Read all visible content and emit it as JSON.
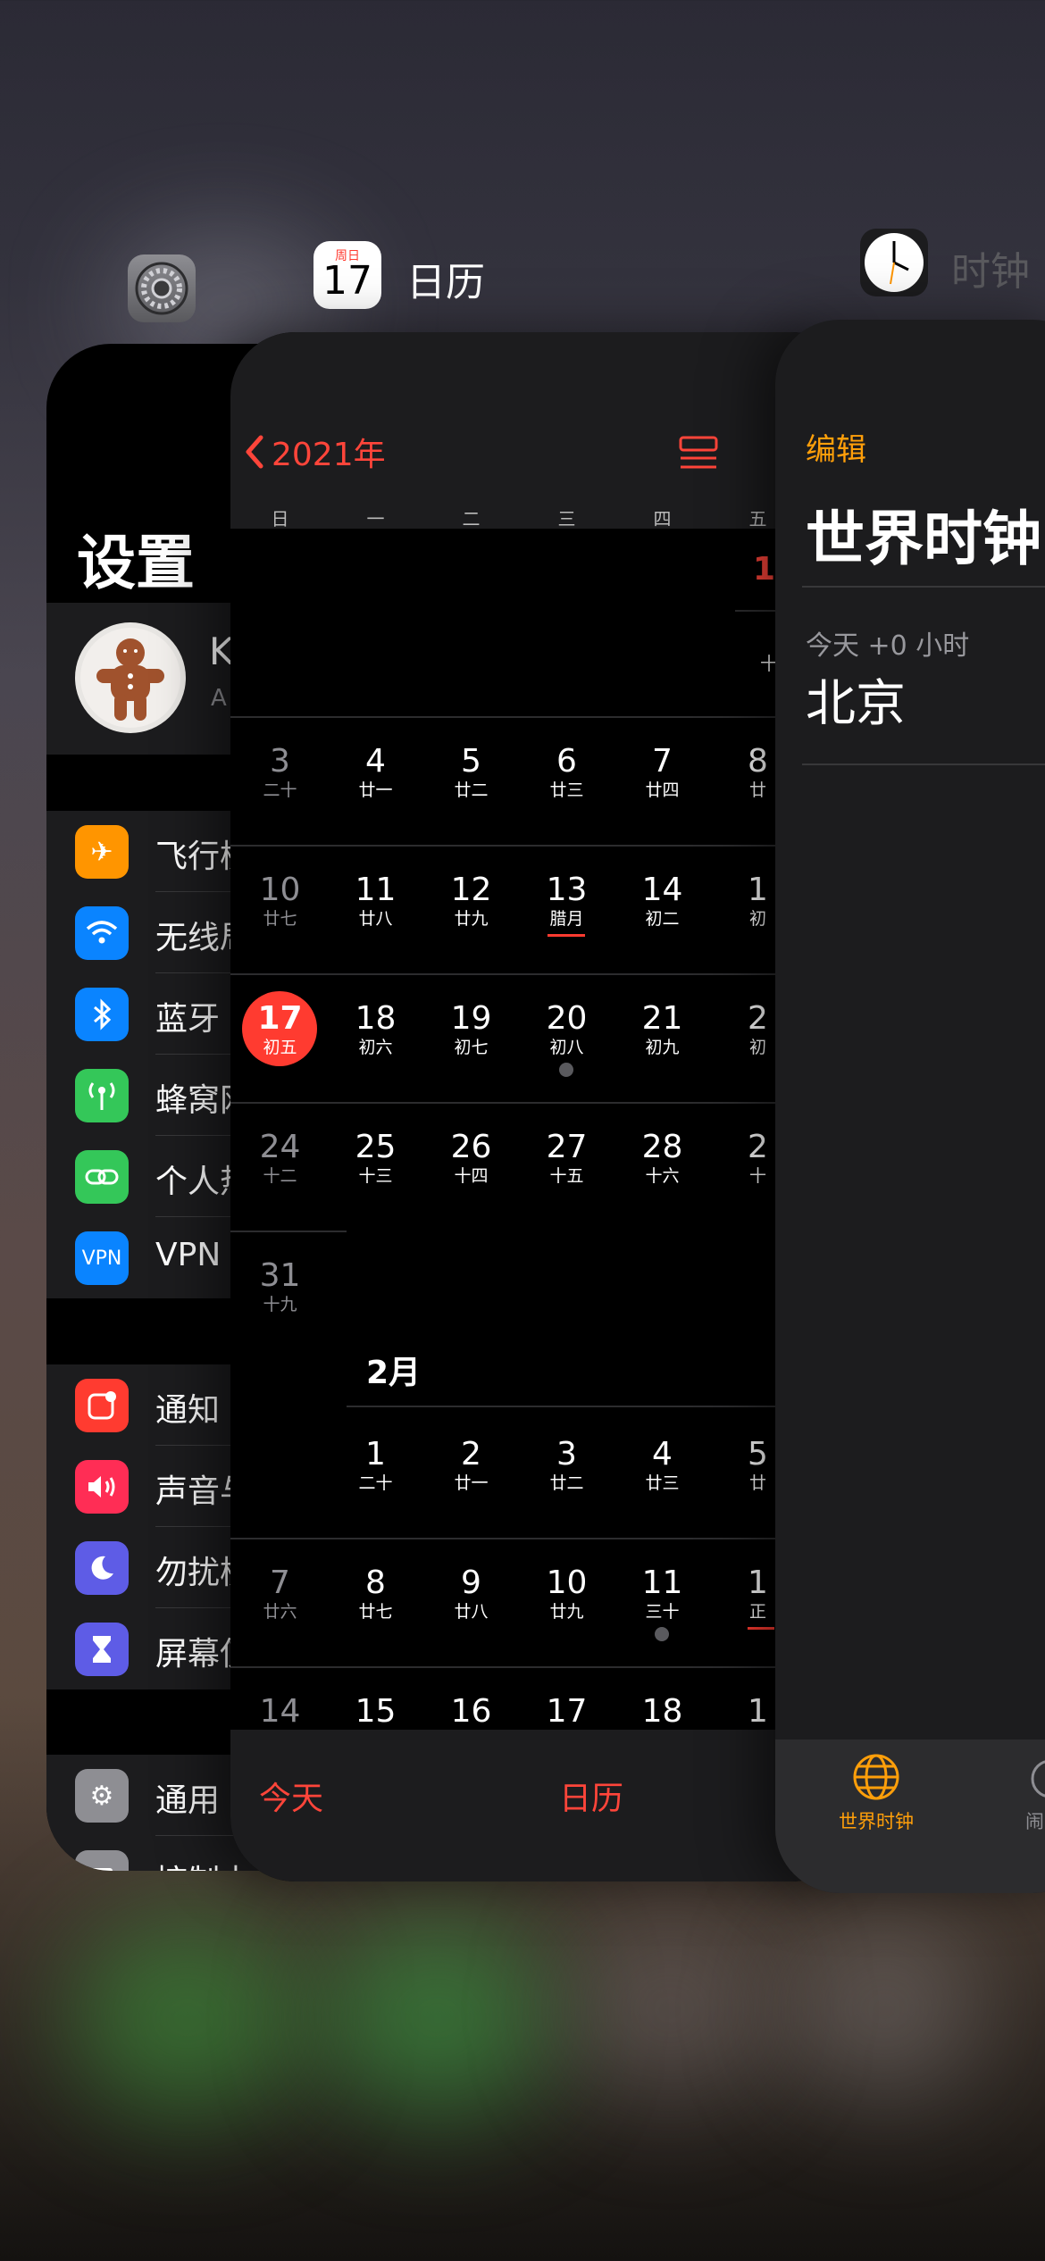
{
  "headers": {
    "calendar_icon_weekday": "周日",
    "calendar_icon_day": "17",
    "calendar_title": "日历",
    "clock_title": "时钟"
  },
  "settings": {
    "title": "设置",
    "profile_initial": "K",
    "profile_sub": "A",
    "group1": [
      {
        "label": "飞行模",
        "icon": "airplane-icon",
        "color": "#ff9500"
      },
      {
        "label": "无线局",
        "icon": "wifi-icon",
        "color": "#0a84ff"
      },
      {
        "label": "蓝牙",
        "icon": "bluetooth-icon",
        "color": "#0a84ff"
      },
      {
        "label": "蜂窝网",
        "icon": "cellular-icon",
        "color": "#34c759"
      },
      {
        "label": "个人热",
        "icon": "hotspot-icon",
        "color": "#34c759"
      },
      {
        "label": "VPN",
        "icon": "vpn-icon",
        "color": "#0a84ff"
      }
    ],
    "group2": [
      {
        "label": "通知",
        "icon": "notification-icon",
        "color": "#ff3b30"
      },
      {
        "label": "声音与",
        "icon": "sound-icon",
        "color": "#ff2d55"
      },
      {
        "label": "勿扰模",
        "icon": "moon-icon",
        "color": "#5e5ce6"
      },
      {
        "label": "屏幕使",
        "icon": "hourglass-icon",
        "color": "#5e5ce6"
      }
    ],
    "group3": [
      {
        "label": "通用",
        "icon": "gear-icon",
        "color": "#8e8e93"
      },
      {
        "label": "控制中心",
        "icon": "control-center-icon",
        "color": "#8e8e93"
      }
    ]
  },
  "calendar": {
    "back_label": "2021年",
    "weekdays": [
      "日",
      "一",
      "二",
      "三",
      "四",
      "五"
    ],
    "jan_first": "1",
    "jan_first_lunar": "十",
    "weeks": [
      [
        [
          "3",
          "二十",
          true
        ],
        [
          "4",
          "廿一",
          false
        ],
        [
          "5",
          "廿二",
          false
        ],
        [
          "6",
          "廿三",
          false
        ],
        [
          "7",
          "廿四",
          false
        ],
        [
          "8",
          "廿",
          false
        ]
      ],
      [
        [
          "10",
          "廿七",
          true
        ],
        [
          "11",
          "廿八",
          false
        ],
        [
          "12",
          "廿九",
          false
        ],
        [
          "13",
          "腊月",
          false
        ],
        [
          "14",
          "初二",
          false
        ],
        [
          "1",
          "初",
          false
        ]
      ],
      [
        [
          "17",
          "初五",
          false
        ],
        [
          "18",
          "初六",
          false
        ],
        [
          "19",
          "初七",
          false
        ],
        [
          "20",
          "初八",
          false
        ],
        [
          "21",
          "初九",
          false
        ],
        [
          "2",
          "初",
          false
        ]
      ],
      [
        [
          "24",
          "十二",
          true
        ],
        [
          "25",
          "十三",
          false
        ],
        [
          "26",
          "十四",
          false
        ],
        [
          "27",
          "十五",
          false
        ],
        [
          "28",
          "十六",
          false
        ],
        [
          "2",
          "十",
          false
        ]
      ],
      [
        [
          "31",
          "十九",
          true
        ]
      ]
    ],
    "feb_label": "2月",
    "feb_weeks": [
      [
        [
          "1",
          "二十",
          false
        ],
        [
          "2",
          "廿一",
          false
        ],
        [
          "3",
          "廿二",
          false
        ],
        [
          "4",
          "廿三",
          false
        ],
        [
          "5",
          "廿",
          false
        ]
      ],
      [
        [
          "7",
          "廿六",
          true
        ],
        [
          "8",
          "廿七",
          false
        ],
        [
          "9",
          "廿八",
          false
        ],
        [
          "10",
          "廿九",
          false
        ],
        [
          "11",
          "三十",
          false
        ],
        [
          "1",
          "正",
          false
        ]
      ],
      [
        [
          "14",
          "",
          true
        ],
        [
          "15",
          "",
          false
        ],
        [
          "16",
          "",
          false
        ],
        [
          "17",
          "",
          false
        ],
        [
          "18",
          "",
          false
        ],
        [
          "1",
          "",
          false
        ]
      ]
    ],
    "tab_today": "今天",
    "tab_calendars": "日历"
  },
  "clock": {
    "edit": "编辑",
    "title": "世界时钟",
    "offset": "今天 +0 小时",
    "city": "北京",
    "tab_world": "世界时钟",
    "tab_alarm": "闹"
  },
  "colors": {
    "red_accent": "#ff453a",
    "orange_accent": "#ff9f0a"
  }
}
